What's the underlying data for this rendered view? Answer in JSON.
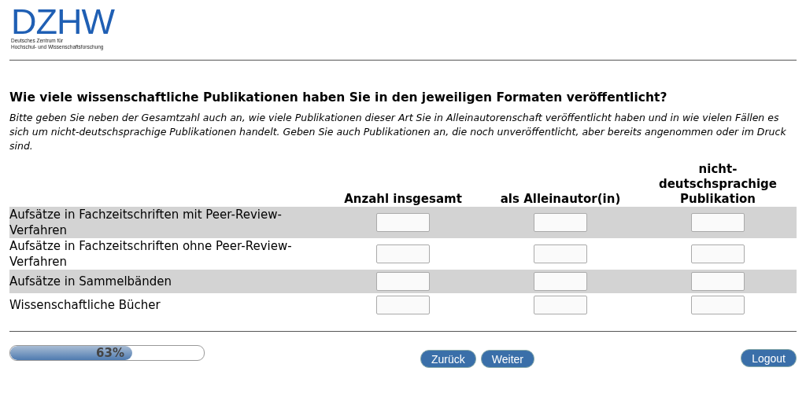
{
  "logo": {
    "wordmark": "DZHW",
    "subtitle_lines": [
      "Deutsches Zentrum für",
      "Hochschul- und Wissenschaftsforschung"
    ]
  },
  "question": {
    "title": "Wie viele wissenschaftliche Publikationen haben Sie in den jeweiligen Formaten veröffentlicht?",
    "instruction": "Bitte geben Sie neben der Gesamtzahl auch an, wie viele Publikationen dieser Art Sie in Alleinautorenschaft veröffentlicht haben und in wie vielen Fällen es sich um nicht-deutschsprachige Publikationen handelt. Geben Sie auch Publikationen an, die noch unveröffentlicht, aber bereits angenommen oder im Druck sind."
  },
  "table": {
    "columns": [
      "Anzahl insgesamt",
      "als Alleinautor(in)",
      "nicht-deutschsprachige Publikation"
    ],
    "rows": [
      {
        "label": "Aufsätze in Fachzeitschriften mit Peer-Review-Verfahren"
      },
      {
        "label": "Aufsätze in Fachzeitschriften ohne Peer-Review-Verfahren"
      },
      {
        "label": "Aufsätze in Sammelbänden"
      },
      {
        "label": "Wissenschaftliche Bücher"
      }
    ]
  },
  "progress": {
    "level": 0.63,
    "reading": "63%"
  },
  "buttons": [
    {
      "label": "Zurück",
      "kind": "nav"
    },
    {
      "label": "Weiter",
      "kind": "nav"
    },
    {
      "label": "Logout",
      "kind": "logout"
    }
  ]
}
